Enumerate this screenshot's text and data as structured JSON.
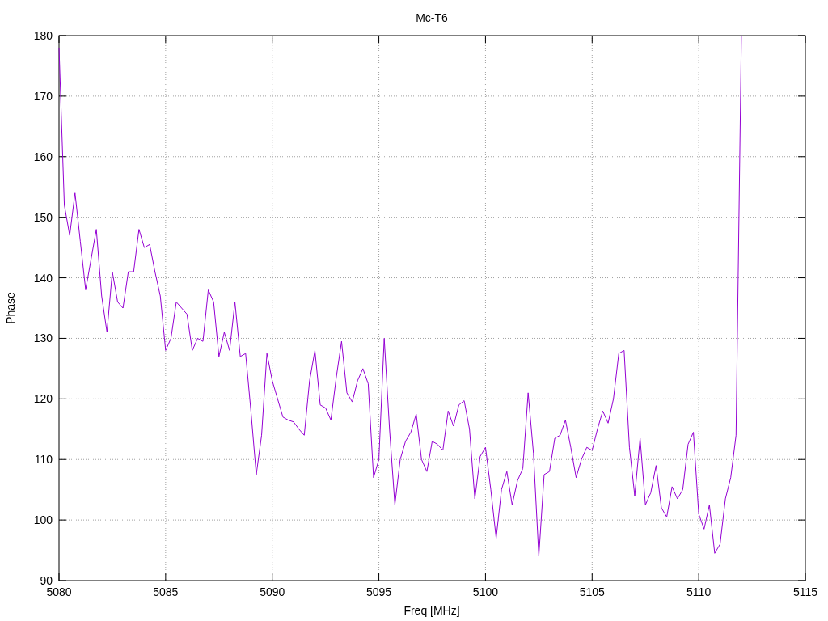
{
  "chart_data": {
    "type": "line",
    "title": "Mc-T6",
    "xlabel": "Freq [MHz]",
    "ylabel": "Phase",
    "x": [
      5080,
      5080.25,
      5080.5,
      5080.75,
      5081,
      5081.25,
      5081.5,
      5081.75,
      5082,
      5082.25,
      5082.5,
      5082.75,
      5083,
      5083.25,
      5083.5,
      5083.75,
      5084,
      5084.25,
      5084.5,
      5084.75,
      5085,
      5085.25,
      5085.5,
      5085.75,
      5086,
      5086.25,
      5086.5,
      5086.75,
      5087,
      5087.25,
      5087.5,
      5087.75,
      5088,
      5088.25,
      5088.5,
      5088.75,
      5089,
      5089.25,
      5089.5,
      5089.75,
      5090,
      5090.25,
      5090.5,
      5090.75,
      5091,
      5091.25,
      5091.5,
      5091.75,
      5092,
      5092.25,
      5092.5,
      5092.75,
      5093,
      5093.25,
      5093.5,
      5093.75,
      5094,
      5094.25,
      5094.5,
      5094.75,
      5095,
      5095.25,
      5095.5,
      5095.75,
      5096,
      5096.25,
      5096.5,
      5096.75,
      5097,
      5097.25,
      5097.5,
      5097.75,
      5098,
      5098.25,
      5098.5,
      5098.75,
      5099,
      5099.25,
      5099.5,
      5099.75,
      5100,
      5100.25,
      5100.5,
      5100.75,
      5101,
      5101.25,
      5101.5,
      5101.75,
      5102,
      5102.25,
      5102.5,
      5102.75,
      5103,
      5103.25,
      5103.5,
      5103.75,
      5104,
      5104.25,
      5104.5,
      5104.75,
      5105,
      5105.25,
      5105.5,
      5105.75,
      5106,
      5106.25,
      5106.5,
      5106.75,
      5107,
      5107.25,
      5107.5,
      5107.75,
      5108,
      5108.25,
      5108.5,
      5108.75,
      5109,
      5109.25,
      5109.5,
      5109.75,
      5110,
      5110.25,
      5110.5,
      5110.75,
      5111,
      5111.25,
      5111.5,
      5111.75,
      5112
    ],
    "series": [
      {
        "color": "#9400d3",
        "values": [
          178,
          152,
          147,
          154,
          146,
          138,
          143,
          148,
          137,
          131,
          141,
          136,
          135,
          141,
          141,
          148,
          145,
          145.5,
          141,
          137,
          128,
          130,
          136,
          135,
          134,
          128,
          130,
          129.5,
          138,
          136,
          127,
          131,
          128,
          136,
          127,
          127.5,
          118,
          107.5,
          114,
          127.5,
          123,
          120,
          117,
          116.5,
          116.2,
          115,
          114,
          123,
          128,
          119,
          118.5,
          116.5,
          123.5,
          129.5,
          121,
          119.5,
          123,
          125,
          122.5,
          107,
          110,
          130,
          115,
          102.5,
          110,
          113,
          114.5,
          117.5,
          110,
          108,
          113,
          112.5,
          111.5,
          118,
          115.5,
          119,
          119.7,
          115,
          103.5,
          110.5,
          112,
          105,
          97,
          105,
          108,
          102.5,
          106.5,
          108.5,
          121,
          111,
          94,
          107.5,
          108,
          113.5,
          114,
          116.5,
          112,
          107,
          110,
          112,
          111.5,
          115,
          118,
          116,
          120,
          127.5,
          128,
          112,
          104,
          113.5,
          102.5,
          104.5,
          109,
          102,
          100.5,
          105.5,
          103.5,
          105,
          112.5,
          114.5,
          101,
          98.5,
          102.5,
          94.5,
          96,
          103.5,
          107,
          114,
          180
        ]
      }
    ],
    "grid": true,
    "xlim": [
      5080,
      5115
    ],
    "ylim": [
      90,
      180
    ],
    "xticks": [
      5080,
      5085,
      5090,
      5095,
      5100,
      5105,
      5110,
      5115
    ],
    "yticks": [
      90,
      100,
      110,
      120,
      130,
      140,
      150,
      160,
      170,
      180
    ]
  }
}
